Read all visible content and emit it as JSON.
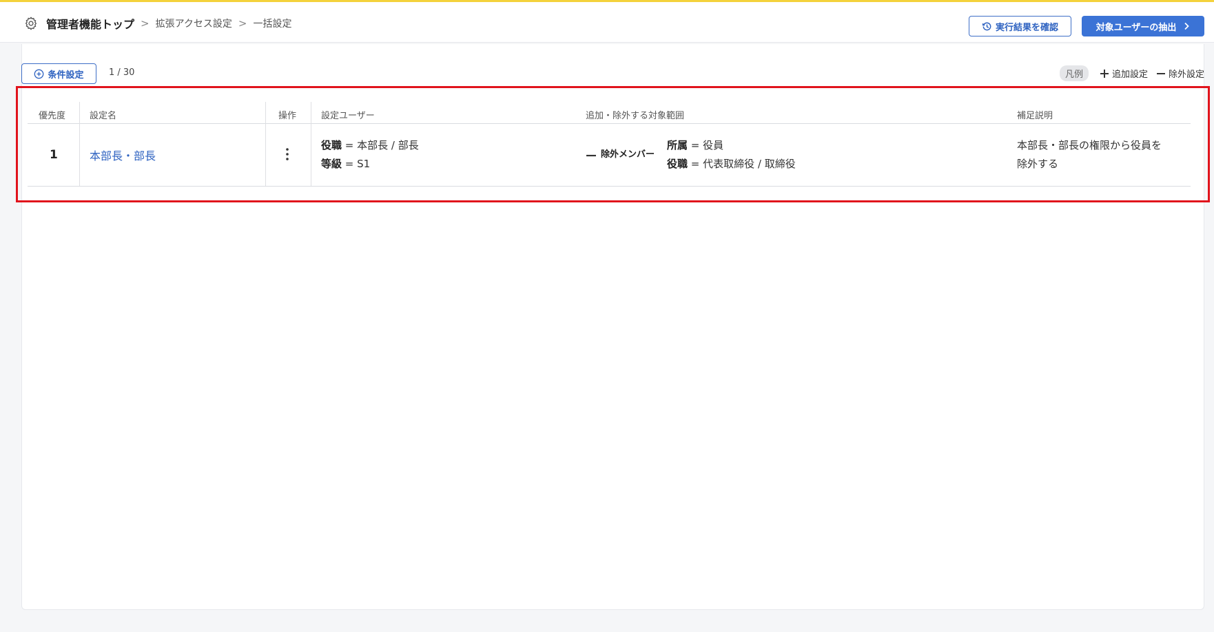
{
  "header": {
    "title": "管理者機能トップ",
    "breadcrumb": [
      "拡張アクセス設定",
      "一括設定"
    ],
    "history_button": "実行結果を確認",
    "extract_button": "対象ユーザーの抽出"
  },
  "toolbar": {
    "condition_button": "条件設定",
    "page_count": "1 / 30"
  },
  "legend": {
    "label": "凡例",
    "add": "追加設定",
    "exclude": "除外設定"
  },
  "table": {
    "columns": [
      "優先度",
      "設定名",
      "操作",
      "設定ユーザー",
      "追加・除外する対象範囲",
      "補足説明"
    ],
    "rows": [
      {
        "priority": "1",
        "name": "本部長・部長",
        "action_icon": "kebab-menu-icon",
        "users": [
          {
            "key": "役職",
            "value": "本部長 / 部長"
          },
          {
            "key": "等級",
            "value": "S1"
          }
        ],
        "scope_type": "除外メンバー",
        "scope": [
          {
            "key": "所属",
            "value": "役員"
          },
          {
            "key": "役職",
            "value": "代表取締役 / 取締役"
          }
        ],
        "note": [
          "本部長・部長の権限から役員を",
          "除外する"
        ]
      }
    ]
  },
  "colors": {
    "accent": "#3b73d6",
    "top_border": "#f4d23c",
    "highlight": "#e1131c"
  }
}
